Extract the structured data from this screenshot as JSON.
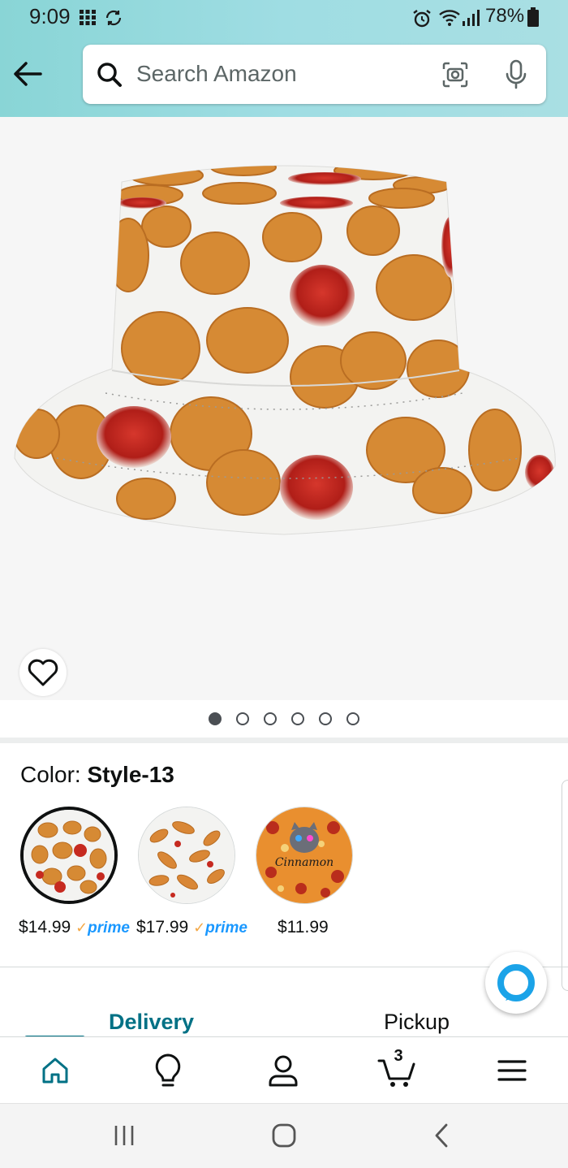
{
  "status_bar": {
    "time": "9:09",
    "battery": "78%"
  },
  "header": {
    "search_placeholder": "Search Amazon"
  },
  "product_image": {
    "dot_count": 6,
    "active_dot": 0
  },
  "color": {
    "label": "Color:",
    "selected": "Style-13",
    "options": [
      {
        "price": "$14.99",
        "prime": true
      },
      {
        "price": "$17.99",
        "prime": true
      },
      {
        "price": "$11.99",
        "prime": false,
        "overlay_text": "Cinnamon"
      }
    ]
  },
  "prime_label": "prime",
  "fulfillment_tabs": [
    {
      "label": "Delivery",
      "active": true
    },
    {
      "label": "Pickup",
      "active": false
    }
  ],
  "bottom_nav": {
    "items": [
      "home-icon",
      "lightbulb-icon",
      "account-icon",
      "cart-icon",
      "menu-icon"
    ],
    "cart_count": "3"
  },
  "colors": {
    "accent": "#007185",
    "header_gradient_start": "#89d5d6",
    "prime_blue": "#1a98ff",
    "alexa_blue": "#1ba3e8"
  }
}
